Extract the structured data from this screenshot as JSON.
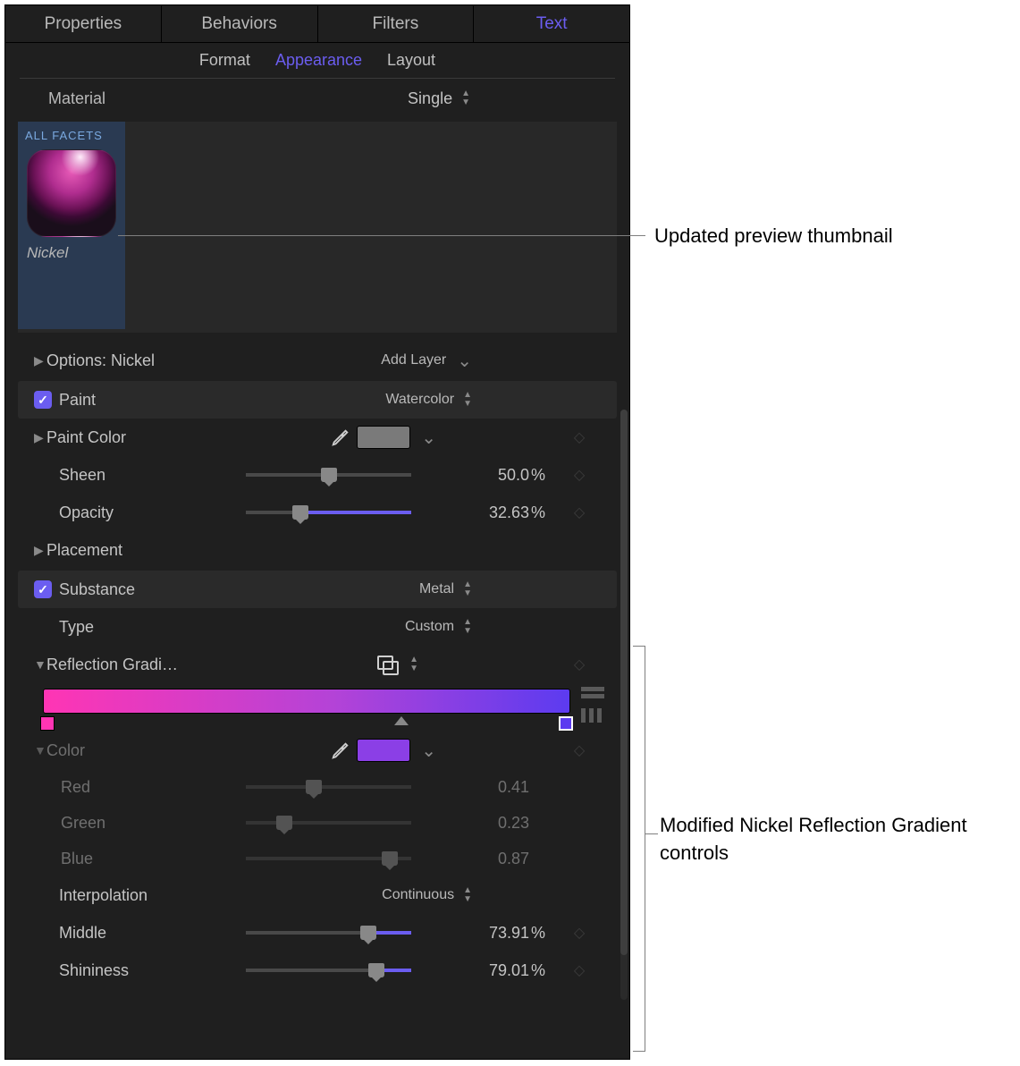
{
  "tabs": {
    "properties": "Properties",
    "behaviors": "Behaviors",
    "filters": "Filters",
    "text": "Text"
  },
  "subtabs": {
    "format": "Format",
    "appearance": "Appearance",
    "layout": "Layout"
  },
  "material": {
    "label": "Material",
    "value": "Single"
  },
  "thumb": {
    "badge": "ALL FACETS",
    "name": "Nickel"
  },
  "options": {
    "label": "Options: Nickel",
    "addlayer": "Add Layer"
  },
  "paint": {
    "label": "Paint",
    "type": "Watercolor",
    "color_label": "Paint Color",
    "color_hex": "#7a7a7a",
    "sheen_label": "Sheen",
    "sheen_value": "50.0",
    "sheen_pct": 50,
    "opacity_label": "Opacity",
    "opacity_value": "32.63",
    "opacity_pct": 32.63,
    "placement_label": "Placement"
  },
  "substance": {
    "label": "Substance",
    "value": "Metal",
    "type_label": "Type",
    "type_value": "Custom",
    "reflection_label": "Reflection Gradi…",
    "color_label": "Color",
    "color_hex": "#8b3fe6",
    "red_label": "Red",
    "red_value": "0.41",
    "green_label": "Green",
    "green_value": "0.23",
    "blue_label": "Blue",
    "blue_value": "0.87",
    "interp_label": "Interpolation",
    "interp_value": "Continuous",
    "middle_label": "Middle",
    "middle_value": "73.91",
    "middle_pct": 73.91,
    "shine_label": "Shininess",
    "shine_value": "79.01",
    "shine_pct": 79.01
  },
  "unit_pct": "%",
  "callouts": {
    "preview": "Updated preview thumbnail",
    "reflection": "Modified Nickel Reflection Gradient controls"
  }
}
